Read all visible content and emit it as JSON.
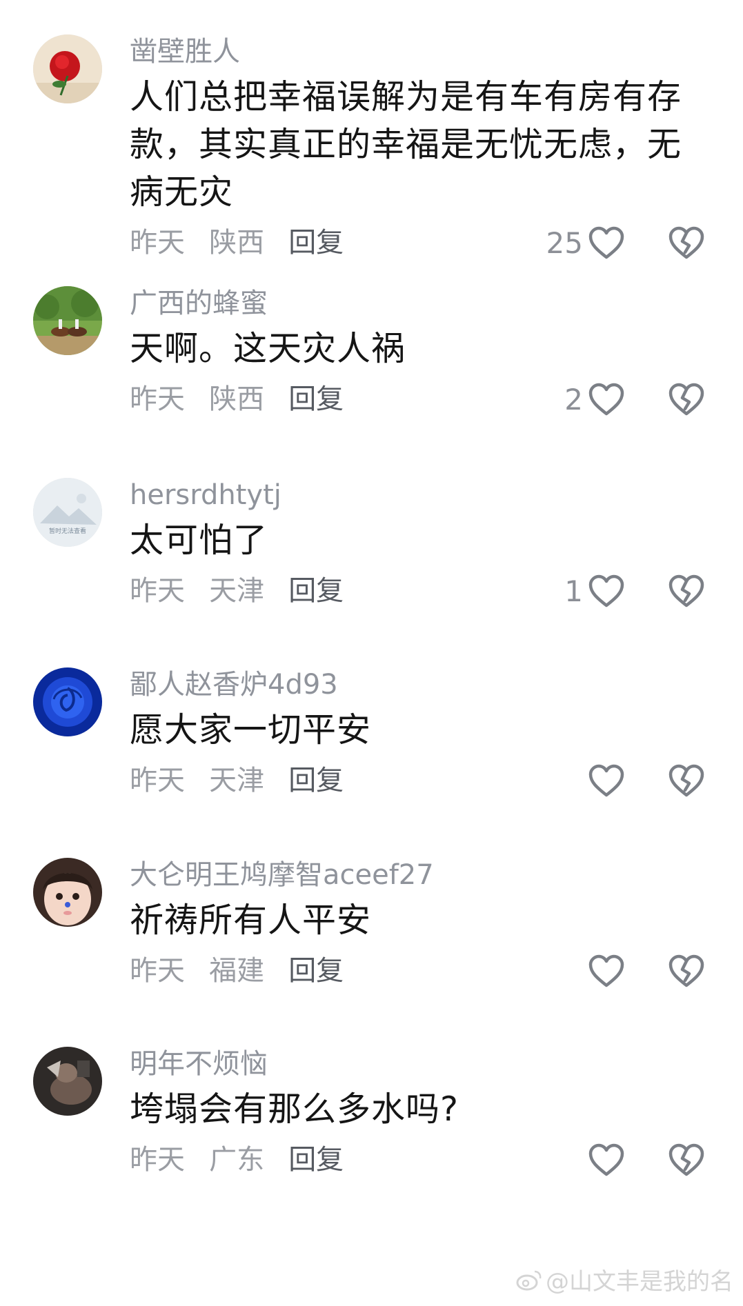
{
  "comments": [
    {
      "username": "凿壁胜人",
      "text": "人们总把幸福误解为是有车有房有存款，其实真正的幸福是无忧无虑，无病无灾",
      "time": "昨天",
      "location": "陕西",
      "reply": "回复",
      "likes": "25"
    },
    {
      "username": "广西的蜂蜜",
      "text": "天啊。这天灾人祸",
      "time": "昨天",
      "location": "陕西",
      "reply": "回复",
      "likes": "2"
    },
    {
      "username": "hersrdhtytj",
      "text": "太可怕了",
      "time": "昨天",
      "location": "天津",
      "reply": "回复",
      "likes": "1",
      "avatar_text": "暂时无法查看"
    },
    {
      "username": "鄙人赵香炉4d93",
      "text": "愿大家一切平安",
      "time": "昨天",
      "location": "天津",
      "reply": "回复",
      "likes": ""
    },
    {
      "username": "大仑明王鸠摩智aceef27",
      "text": "祈祷所有人平安",
      "time": "昨天",
      "location": "福建",
      "reply": "回复",
      "likes": ""
    },
    {
      "username": "明年不烦恼",
      "text": "垮塌会有那么多水吗?",
      "time": "昨天",
      "location": "广东",
      "reply": "回复",
      "likes": ""
    }
  ],
  "watermark": {
    "text": "@山文丰是我的名"
  },
  "icons": {
    "like": "heart-outline-icon",
    "dislike": "broken-heart-icon"
  },
  "colors": {
    "username": "#8f939b",
    "text": "#151515",
    "meta": "#9a9da3",
    "reply": "#565a61",
    "icon": "#7b7f86"
  }
}
